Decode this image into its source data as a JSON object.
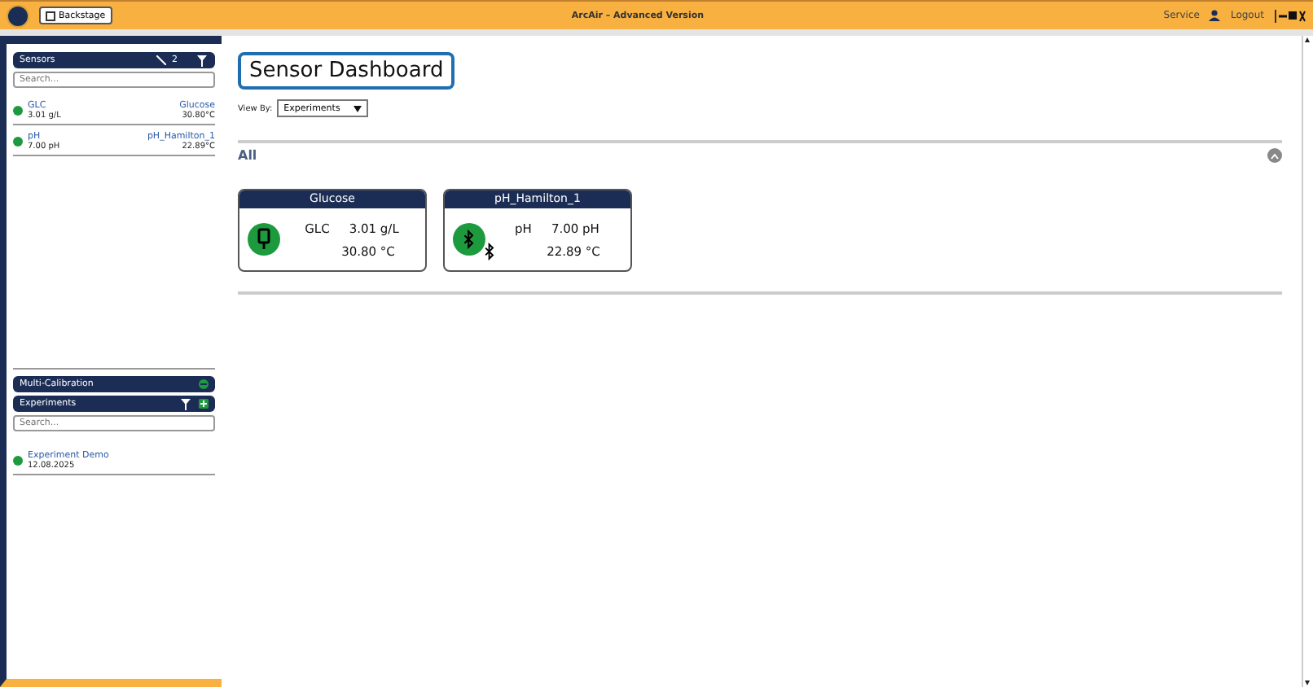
{
  "topbar": {
    "backstage_label": "Backstage",
    "title": "ArcAir – Advanced Version",
    "service_label": "Service",
    "logout_label": "Logout"
  },
  "sidebar": {
    "sensors_header": {
      "title": "Sensors",
      "count": "2"
    },
    "sensors_search": {
      "placeholder": "Search..."
    },
    "sensors": [
      {
        "name": "GLC",
        "reading": "3.01 g/L",
        "device": "Glucose",
        "temperature": "30.80°C"
      },
      {
        "name": "pH",
        "reading": "7.00 pH",
        "device": "pH_Hamilton_1",
        "temperature": "22.89°C"
      }
    ],
    "multi_calibration": {
      "title": "Multi-Calibration"
    },
    "experiments_header": {
      "title": "Experiments"
    },
    "experiments_search": {
      "placeholder": "Search..."
    },
    "experiments": [
      {
        "name": "Experiment Demo",
        "date": "12.08.2025",
        "color": "#1e9a3e"
      }
    ]
  },
  "main": {
    "title": "Sensor Dashboard",
    "view_by": {
      "label": "View By:",
      "value": "Experiments"
    },
    "group": {
      "title": "All",
      "expanded": true,
      "cards": [
        {
          "device": "Glucose",
          "name": "GLC",
          "reading": "3.01 g/L",
          "temperature": "30.80 °C",
          "kind": "usb"
        },
        {
          "device": "pH_Hamilton_1",
          "name": "pH",
          "reading": "7.00 pH",
          "temperature": "22.89 °C",
          "kind": "bluetooth"
        }
      ]
    }
  }
}
